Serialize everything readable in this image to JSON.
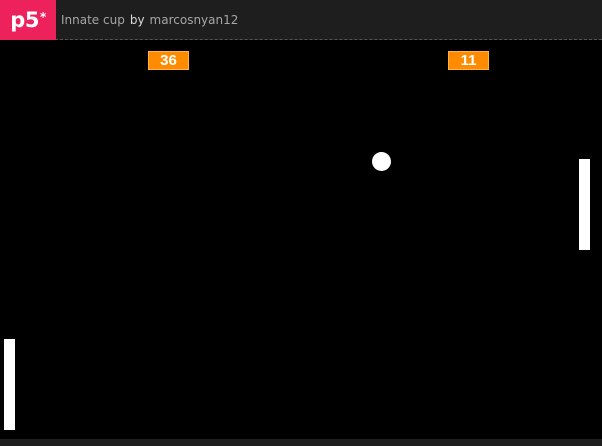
{
  "header": {
    "logo_text": "p5",
    "logo_sup": "*",
    "sketch_title": "Innate cup",
    "by_label": "by",
    "author": "marcosnyan12"
  },
  "game": {
    "score_left": "36",
    "score_right": "11"
  },
  "colors": {
    "logo_bg": "#ed225d",
    "score_bg": "#ff8c00",
    "canvas_bg": "#000000",
    "topbar_bg": "#1e1e1e"
  }
}
